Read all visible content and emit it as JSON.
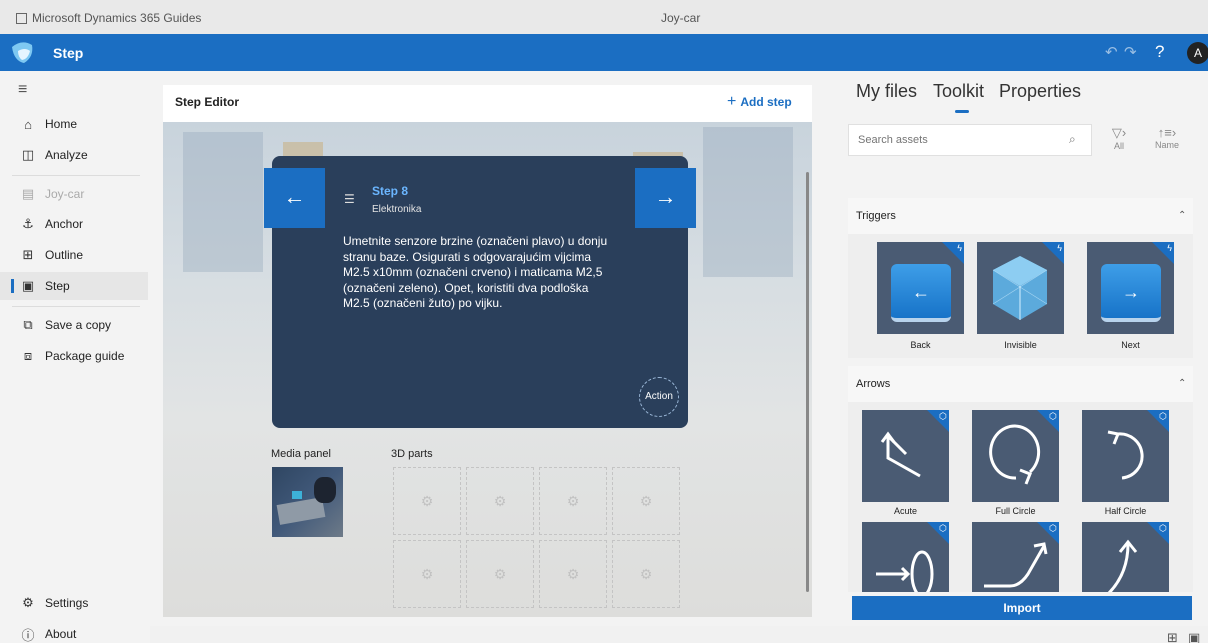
{
  "os_titlebar": {
    "app_name": "Microsoft Dynamics 365 Guides",
    "document": "Joy-car"
  },
  "appbar": {
    "mode": "Step",
    "help": "?",
    "avatar": "A"
  },
  "nav": {
    "items": [
      {
        "label": "Home",
        "icon": "home-icon",
        "glyph": "⌂"
      },
      {
        "label": "Analyze",
        "icon": "analyze-icon",
        "glyph": "◫"
      },
      {
        "label": "Joy-car",
        "icon": "guide-icon",
        "glyph": "▤"
      },
      {
        "label": "Anchor",
        "icon": "anchor-icon",
        "glyph": "⚓"
      },
      {
        "label": "Outline",
        "icon": "outline-icon",
        "glyph": "⊞"
      },
      {
        "label": "Step",
        "icon": "step-icon",
        "glyph": "▣"
      },
      {
        "label": "Save a copy",
        "icon": "save-copy-icon",
        "glyph": "⧉"
      },
      {
        "label": "Package guide",
        "icon": "package-icon",
        "glyph": "⧈"
      }
    ],
    "settings": "Settings",
    "about": "About"
  },
  "editor": {
    "title": "Step Editor",
    "add_step": "Add step",
    "card": {
      "step_title": "Step 8",
      "subtitle": "Elektronika",
      "body": "Umetnite senzore brzine (označeni plavo) u donju stranu baze. Osigurati s odgovarajućim vijcima M2.5 x10mm (označeni crveno) i maticama M2,5 (označeni zeleno). Opet, koristiti dva podloška M2.5 (označeni žuto) po vijku.",
      "action": "Action"
    },
    "media_panel": "Media panel",
    "parts_label": "3D parts"
  },
  "right_panel": {
    "tabs": [
      "My files",
      "Toolkit",
      "Properties"
    ],
    "active_tab": "Toolkit",
    "search_placeholder": "Search assets",
    "filter": "All",
    "sort": "Name",
    "triggers": {
      "title": "Triggers",
      "items": [
        "Back",
        "Invisible",
        "Next"
      ]
    },
    "arrows": {
      "title": "Arrows",
      "items": [
        "Acute",
        "Full Circle",
        "Half Circle"
      ]
    },
    "import": "Import"
  },
  "colors": {
    "accent": "#1b6ec2",
    "card": "#2a3f5b",
    "tile": "#4a5b73"
  }
}
